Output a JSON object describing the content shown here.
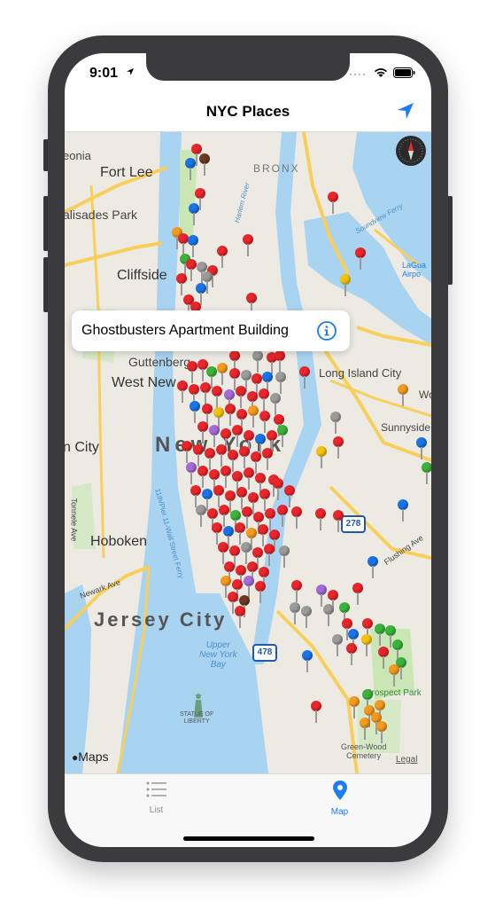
{
  "status_bar": {
    "time": "9:01"
  },
  "nav": {
    "title": "NYC Places"
  },
  "callout": {
    "title": "Ghostbusters Apartment Building"
  },
  "map": {
    "labels": {
      "leonia": "eonia",
      "fort_lee": "Fort Lee",
      "bronx": "BRONX",
      "palisades_park": "alisades Park",
      "cliffside": "Cliffside",
      "guttenberg": "Guttenberg",
      "west_new_york": "West New",
      "long_island_city": "Long Island City",
      "sunnyside": "Sunnyside",
      "union_city": "n City",
      "new_york": "New York",
      "hoboken": "Hoboken",
      "jersey_city": "Jersey City",
      "upper_bay": "Upper\nNew York\nBay",
      "statue": "STATUE OF\nLIBERTY",
      "greenwood": "Green-Wood\nCemetery",
      "prospect_park": "Prospect Park",
      "laguardia": "LaGua\nAirpo",
      "harlem_river": "Harlem River",
      "soundview": "Soundview Ferry",
      "flushing_ave": "Flushing Ave",
      "tonnele": "Tonnele Ave",
      "newark_ave": "Newark Ave",
      "pier11": "11th/Pier 11-Wall Street Ferry",
      "wo": "Wo",
      "maps": "Maps",
      "legal": "Legal",
      "hwy_278_top": "278",
      "hwy_478": "478"
    }
  },
  "tabs": [
    {
      "label": "List",
      "active": false,
      "icon": "list-icon"
    },
    {
      "label": "Map",
      "active": true,
      "icon": "map-pin-icon"
    }
  ],
  "colors": {
    "accent": "#1e7cf2",
    "pin_red": "#e9262b",
    "pin_blue": "#1a73e8",
    "pin_green": "#3bb33b",
    "pin_orange": "#f39a1f",
    "pin_gray": "#9b9b9b",
    "pin_yellow": "#f4c20d",
    "pin_purple": "#a46ad6",
    "pin_brown": "#6b3a1f",
    "water": "#a8d3f1",
    "land": "#eceae3",
    "park": "#c9e6b4",
    "road": "#f7cf5a"
  }
}
